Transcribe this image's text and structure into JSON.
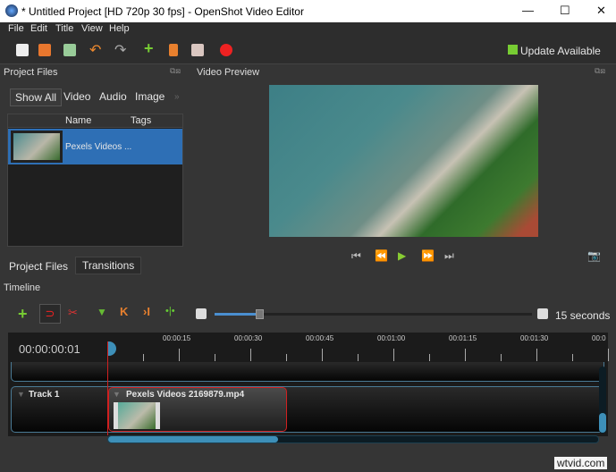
{
  "window": {
    "title": "* Untitled Project [HD 720p 30 fps] - OpenShot Video Editor"
  },
  "menu": [
    "File",
    "Edit",
    "Title",
    "View",
    "Help"
  ],
  "toolbar": {
    "update": "Update Available"
  },
  "project_files": {
    "title": "Project Files",
    "filters": [
      "Show All",
      "Video",
      "Audio",
      "Image"
    ],
    "more": "»",
    "columns": [
      "Name",
      "Tags"
    ],
    "files": [
      {
        "name": "Pexels Videos ..."
      }
    ],
    "bottom_tabs": [
      "Project Files",
      "Transitions"
    ]
  },
  "preview": {
    "title": "Video Preview"
  },
  "timeline": {
    "title": "Timeline",
    "zoom_label": "15 seconds",
    "timecode": "00:00:00:01",
    "zoom_fraction": 0.14,
    "ruler": [
      "00:00:15",
      "00:00:30",
      "00:00:45",
      "00:01:00",
      "00:01:15",
      "00:01:30",
      "00:0"
    ],
    "tracks": [
      {
        "name": "Track 1",
        "clip": "Pexels Videos 2169879.mp4"
      }
    ]
  },
  "watermark": "wtvid.com",
  "colors": {
    "accent": "#3d8fb8",
    "clip_border": "#d02020",
    "selected": "#2e6fb5"
  }
}
